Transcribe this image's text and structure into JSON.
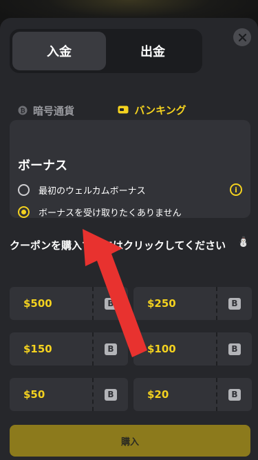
{
  "tabs": {
    "deposit": "入金",
    "withdraw": "出金"
  },
  "payment_methods": {
    "crypto": "暗号通貨",
    "banking": "バンキング"
  },
  "bonus": {
    "title": "ボーナス",
    "options": [
      {
        "label": "最初のウェルカムボーナス",
        "checked": false
      },
      {
        "label": "ボーナスを受け取りたくありません",
        "checked": true
      }
    ],
    "info_icon": "i"
  },
  "coupons": {
    "heading": "クーポンを購入するにはクリックしてください",
    "emoji": "⛄",
    "badge": "B",
    "items": [
      "$500",
      "$250",
      "$150",
      "$100",
      "$50",
      "$20"
    ]
  },
  "buy_label": "購入",
  "colors": {
    "accent": "#f4d21f",
    "arrow": "#e8322f",
    "panel": "#26272b",
    "card": "#323338"
  }
}
